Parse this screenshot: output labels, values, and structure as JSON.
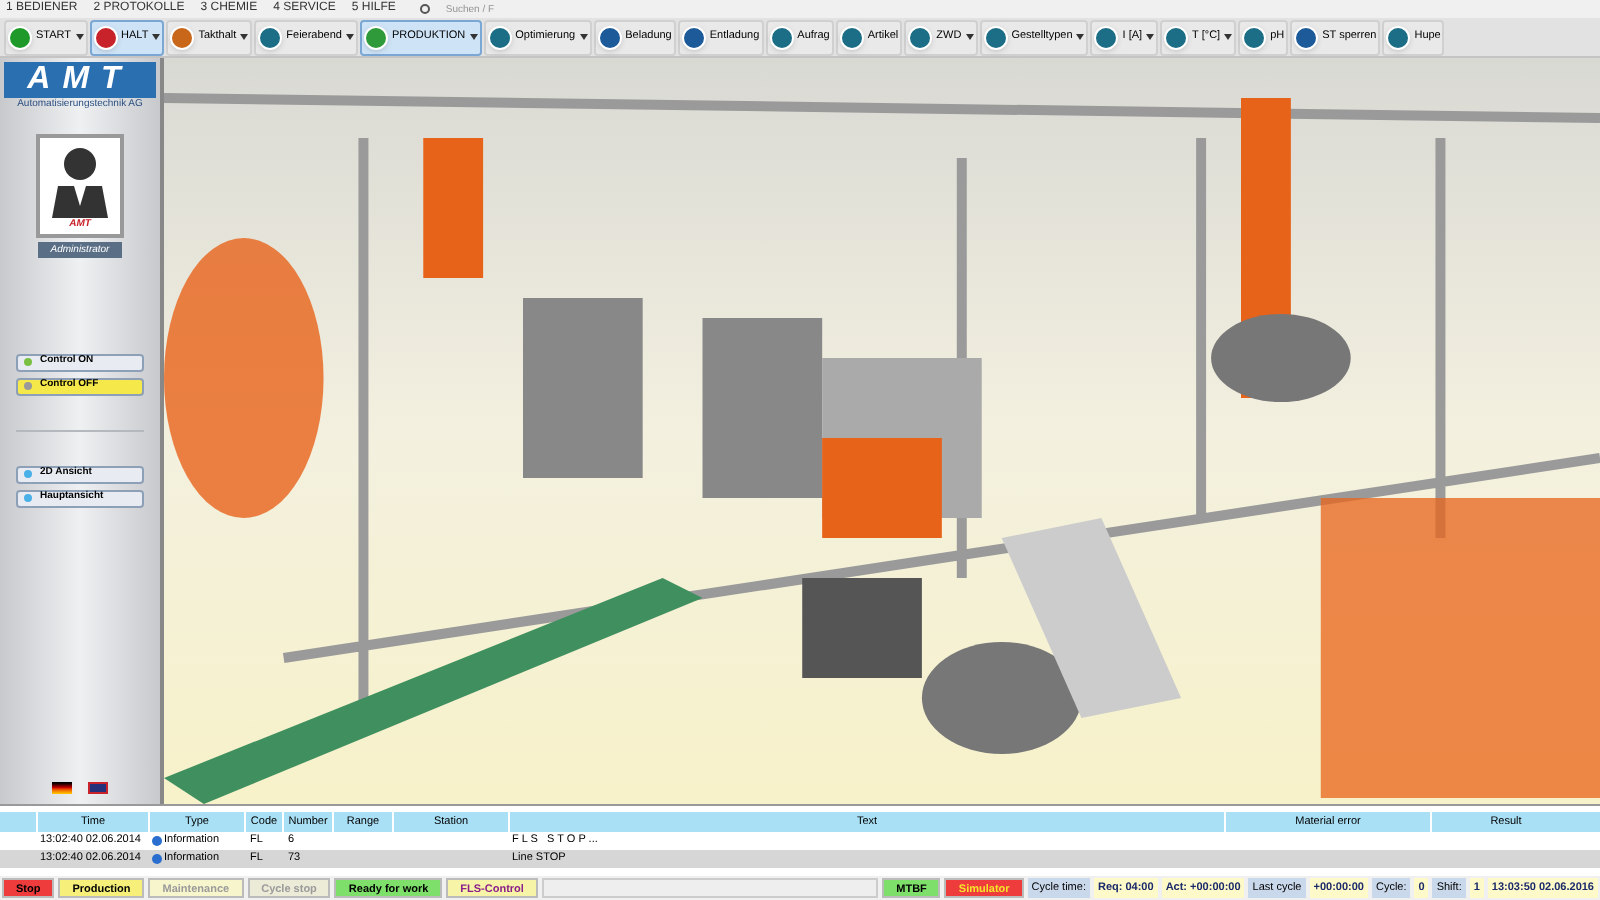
{
  "menu": [
    {
      "label": "1 BEDIENER"
    },
    {
      "label": "2 PROTOKOLLE"
    },
    {
      "label": "3 CHEMIE"
    },
    {
      "label": "4 SERVICE"
    },
    {
      "label": "5 HILFE"
    }
  ],
  "search": {
    "placeholder": "Suchen / F"
  },
  "toolbar": [
    {
      "label": "START",
      "selected": false,
      "dropdown": true,
      "color": "#1f9a2a"
    },
    {
      "label": "HALT",
      "selected": true,
      "dropdown": true,
      "color": "#c8232a"
    },
    {
      "label": "Takthalt",
      "selected": false,
      "dropdown": true,
      "color": "#c8661a"
    },
    {
      "label": "Feierabend",
      "selected": false,
      "dropdown": true,
      "color": "#1c6e86"
    },
    {
      "label": "PRODUKTION",
      "selected": true,
      "dropdown": true,
      "color": "#2f9a3a"
    },
    {
      "label": "Optimierung",
      "selected": false,
      "dropdown": true,
      "color": "#1c6e86"
    },
    {
      "label": "Beladung",
      "selected": false,
      "dropdown": false,
      "color": "#1d5a9a"
    },
    {
      "label": "Entladung",
      "selected": false,
      "dropdown": false,
      "color": "#1d5a9a"
    },
    {
      "label": "Aufrag",
      "selected": false,
      "dropdown": false,
      "color": "#1c6e86"
    },
    {
      "label": "Artikel",
      "selected": false,
      "dropdown": false,
      "color": "#1c6e86"
    },
    {
      "label": "ZWD",
      "selected": false,
      "dropdown": true,
      "color": "#1c6e86"
    },
    {
      "label": "Gestelltypen",
      "selected": false,
      "dropdown": true,
      "color": "#1c6e86"
    },
    {
      "label": "I [A]",
      "selected": false,
      "dropdown": true,
      "color": "#1c6e86"
    },
    {
      "label": "T [°C]",
      "selected": false,
      "dropdown": true,
      "color": "#1c6e86"
    },
    {
      "label": "pH",
      "selected": false,
      "dropdown": false,
      "color": "#1c6e86"
    },
    {
      "label": "ST sperren",
      "selected": false,
      "dropdown": false,
      "color": "#1d5a9a"
    },
    {
      "label": "Hupe",
      "selected": false,
      "dropdown": false,
      "color": "#1c6e86"
    }
  ],
  "sidebar": {
    "logo": "AMT",
    "company": "Automatisierungstechnik AG",
    "badge": "AMT",
    "role": "Administrator",
    "buttons": [
      {
        "label": "Control ON",
        "selected": false,
        "color": "#7ac143"
      },
      {
        "label": "Control OFF",
        "selected": true,
        "color": "#9a9a9a"
      }
    ],
    "view_buttons": [
      {
        "label": "2D Ansicht"
      },
      {
        "label": "Hauptansicht"
      }
    ]
  },
  "table": {
    "columns": [
      "Time",
      "Type",
      "Code",
      "Number",
      "Range",
      "Station",
      "Text",
      "Material error",
      "Result"
    ],
    "rows": [
      {
        "time": "13:02:40  02.06.2014",
        "type": "Information",
        "code": "FL",
        "number": "6",
        "text": "F L S   S T O P ..."
      },
      {
        "time": "13:02:40  02.06.2014",
        "type": "Information",
        "code": "FL",
        "number": "73",
        "text": "Line STOP"
      }
    ]
  },
  "status_bar": [
    {
      "kind": "state",
      "text": "Stop",
      "color": "#ee3b3b",
      "disabled": false
    },
    {
      "kind": "state",
      "text": "Production",
      "color": "#f6f07a",
      "disabled": false
    },
    {
      "kind": "state",
      "text": "Maintenance",
      "color": "#f7f5cc",
      "disabled": true
    },
    {
      "kind": "state",
      "text": "Cycle stop",
      "color": "#ecebd8",
      "disabled": true
    },
    {
      "kind": "state",
      "text": "Ready for work",
      "color": "#7ee06a",
      "disabled": false
    },
    {
      "kind": "control",
      "text": "FLS-Control",
      "color": "#f7f4a8",
      "disabled": false
    },
    {
      "kind": "blank"
    },
    {
      "kind": "state",
      "text": "MTBF",
      "color": "#7ee06a",
      "disabled": false
    },
    {
      "kind": "alarm",
      "text": "Simulator",
      "color": "#ee3b3b",
      "disabled": false
    },
    {
      "kind": "label",
      "text": "Cycle time:"
    },
    {
      "kind": "value",
      "text": "Req: 04:00"
    },
    {
      "kind": "value",
      "text": "Act: +00:00:00"
    },
    {
      "kind": "label",
      "text": "Last cycle"
    },
    {
      "kind": "value",
      "text": "+00:00:00"
    },
    {
      "kind": "label",
      "text": "Cycle:"
    },
    {
      "kind": "value",
      "text": "0"
    },
    {
      "kind": "label",
      "text": "Shift:"
    },
    {
      "kind": "value",
      "text": "1"
    },
    {
      "kind": "value",
      "text": "13:03:50  02.06.2016"
    }
  ]
}
